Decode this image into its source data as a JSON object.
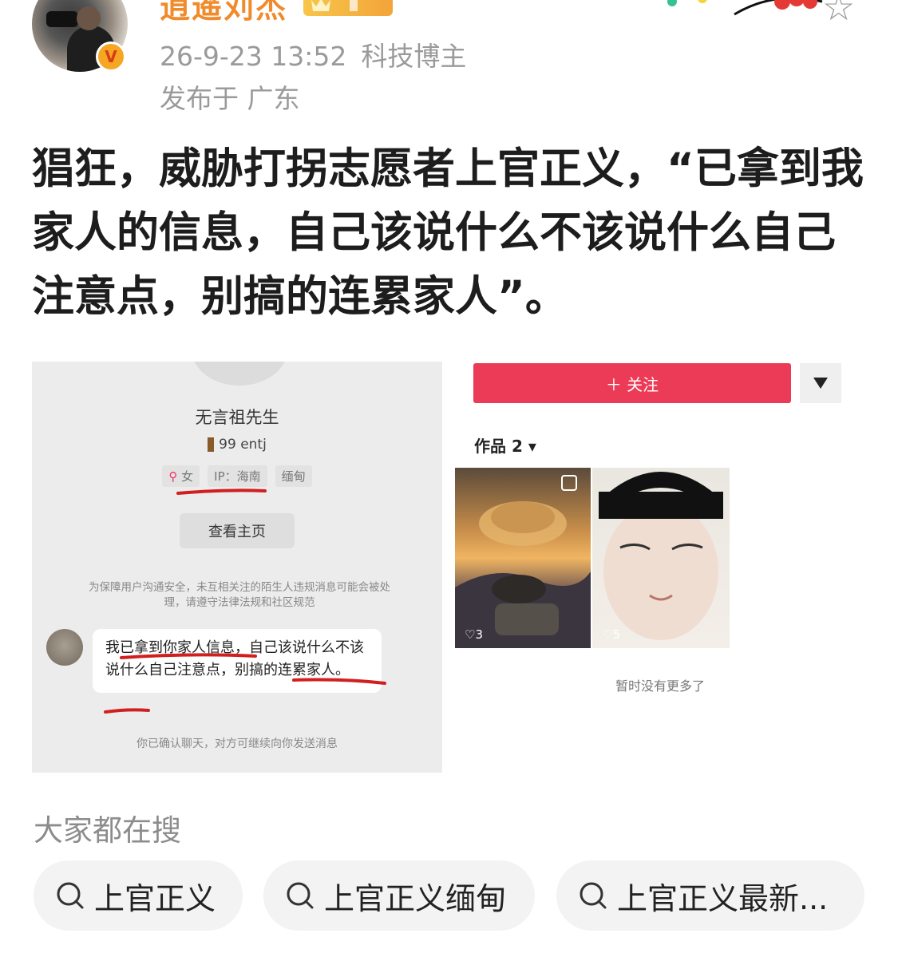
{
  "header": {
    "username": "逍遥刘杰",
    "timestamp": "26-9-23 13:52",
    "role_tag": "科技博主",
    "location": "发布于 广东",
    "username_color": "#f08a2a"
  },
  "post": {
    "text": "猖狂，威胁打拐志愿者上官正义，“已拿到我家人的信息，自己该说什么不该说什么自己注意点，别搞的连累家人”。"
  },
  "left_screenshot": {
    "name": "无言祖先生",
    "sub": "99 entj",
    "tags": [
      "女",
      "IP：海南",
      "缅甸"
    ],
    "view_home_button": "查看主页",
    "notice": "为保障用户沟通安全，未互相关注的陌生人违规消息可能会被处理，请遵守法律法规和社区规范",
    "message": "我已拿到你家人信息，自己该说什么不该说什么自己注意点，别搞的连累家人。",
    "footer": "你已确认聊天，对方可继续向你发送消息",
    "underline_color": "#d11f1f"
  },
  "right_screenshot": {
    "follow_button": "＋ 关注",
    "works_label": "作品 2 ▾",
    "thumbs": [
      {
        "likes": "3"
      },
      {
        "likes": "5"
      }
    ],
    "no_more": "暂时没有更多了",
    "follow_color": "#ec3b56"
  },
  "searches": {
    "title": "大家都在搜",
    "items": [
      "上官正义",
      "上官正义缅甸",
      "上官正义最新..."
    ]
  }
}
